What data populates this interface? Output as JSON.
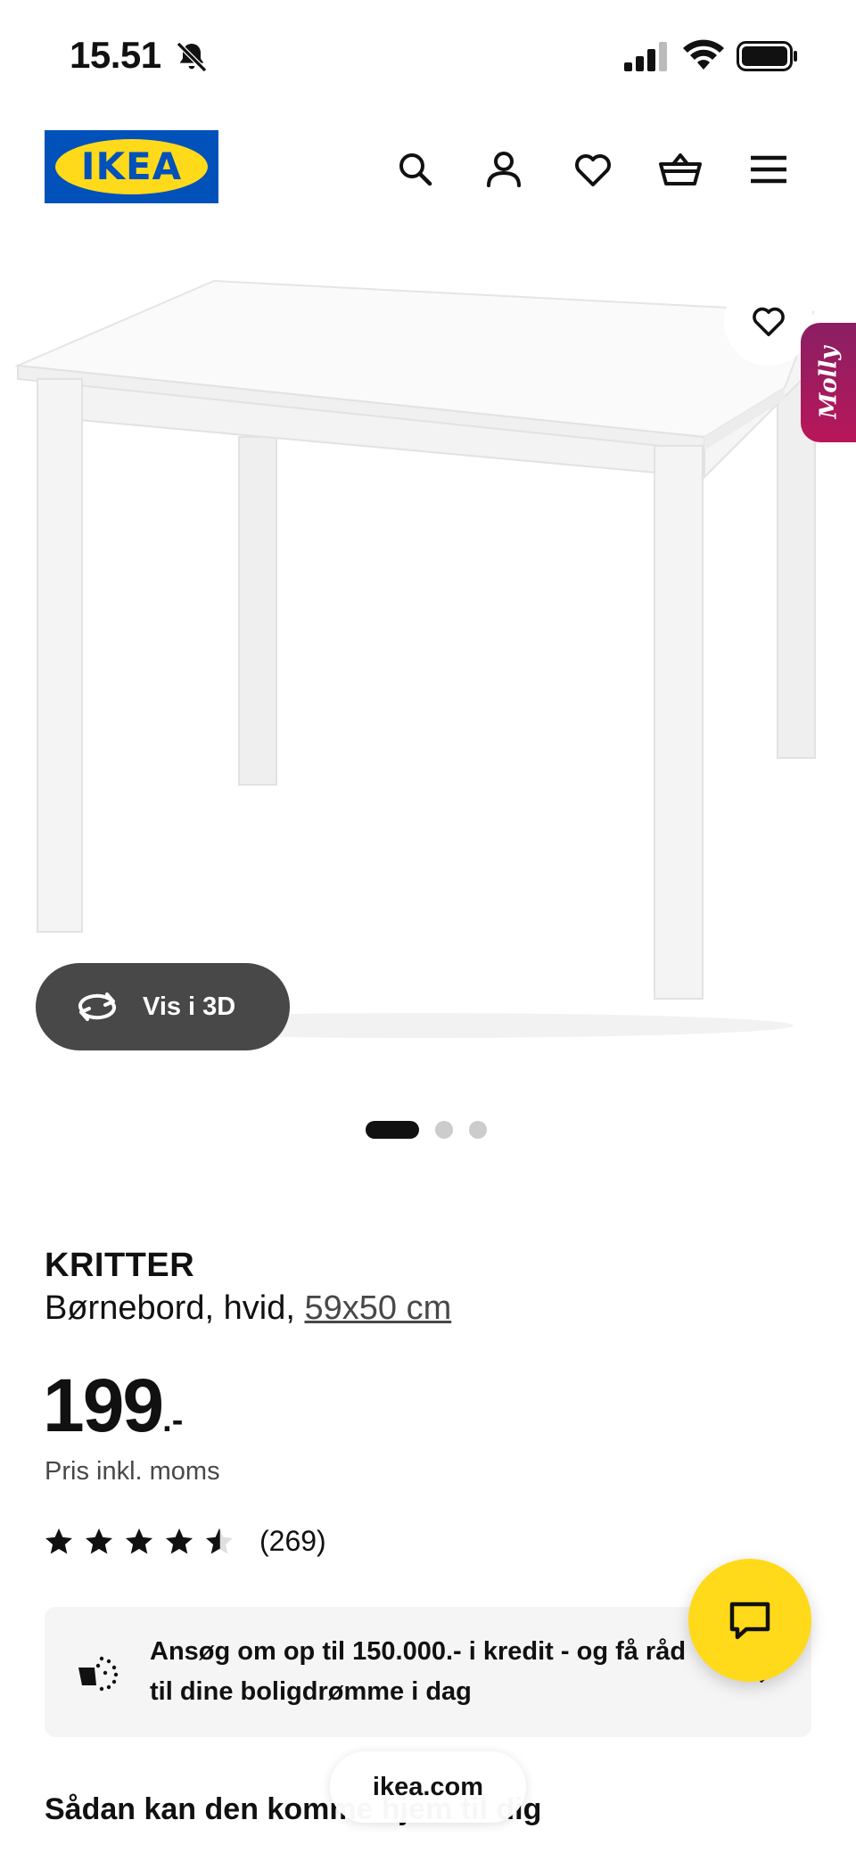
{
  "status_bar": {
    "time": "15.51",
    "icons": [
      "bell-slash-icon",
      "signal-icon",
      "wifi-icon",
      "battery-icon"
    ]
  },
  "header": {
    "logo_text": "IKEA",
    "icons": [
      "search-icon",
      "account-icon",
      "heart-icon",
      "basket-icon",
      "menu-icon"
    ]
  },
  "gallery": {
    "molly_label": "Molly",
    "view_3d_label": "Vis i 3D",
    "slide_count": 3,
    "active_slide": 1
  },
  "product": {
    "name": "KRITTER",
    "description": "Børnebord, hvid, ",
    "dimensions": "59x50 cm",
    "price_main": "199",
    "price_suffix": ".-",
    "price_note": "Pris inkl. moms",
    "rating_value": 4.5,
    "rating_max": 5,
    "rating_count": "(269)"
  },
  "credit_banner": {
    "text": "Ansøg om op til 150.000.- i kredit - og få råd til dine boligdrømme i dag"
  },
  "delivery": {
    "heading": "Sådan kan den komme hjem til dig"
  },
  "browser": {
    "url": "ikea.com"
  },
  "colors": {
    "ikea_blue": "#0051ba",
    "ikea_yellow": "#ffda1a",
    "molly_magenta": "#a3175e",
    "button_dark": "#484848"
  }
}
